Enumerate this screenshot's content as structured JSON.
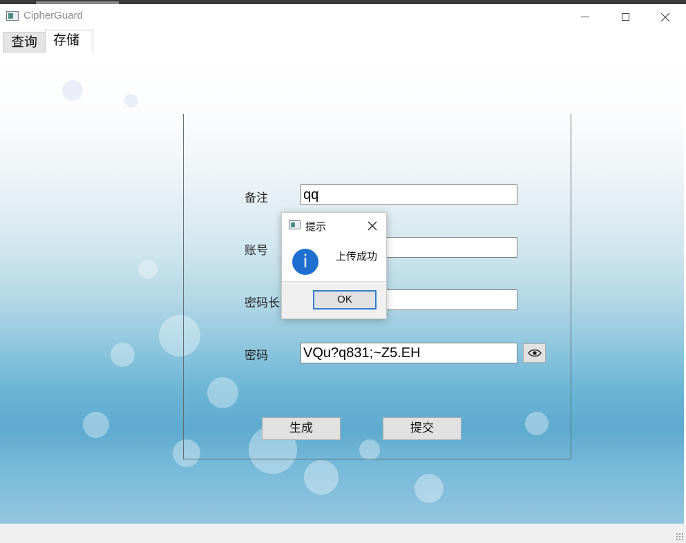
{
  "window": {
    "title": "CipherGuard",
    "controls": {
      "minimize": "minimize-icon",
      "maximize": "maximize-icon",
      "close": "close-icon"
    }
  },
  "tabs": [
    {
      "label": "查询",
      "active": false
    },
    {
      "label": "存储",
      "active": true
    }
  ],
  "form": {
    "note_label": "备注",
    "note_value": "qq",
    "account_label": "账号",
    "account_value": "",
    "length_label": "密码长",
    "length_value": "",
    "password_label": "密码",
    "password_value": "VQu?q831;~Z5.EH",
    "show_password_icon": "eye-icon",
    "generate_button": "生成",
    "submit_button": "提交"
  },
  "dialog": {
    "title": "提示",
    "message": "上传成功",
    "icon": "info-icon",
    "ok_button": "OK"
  },
  "colors": {
    "info_icon": "#1f6fd1",
    "ok_button_border": "#2f7bd0",
    "background_top": "#ffffff",
    "background_bottom": "#5eaad0"
  }
}
